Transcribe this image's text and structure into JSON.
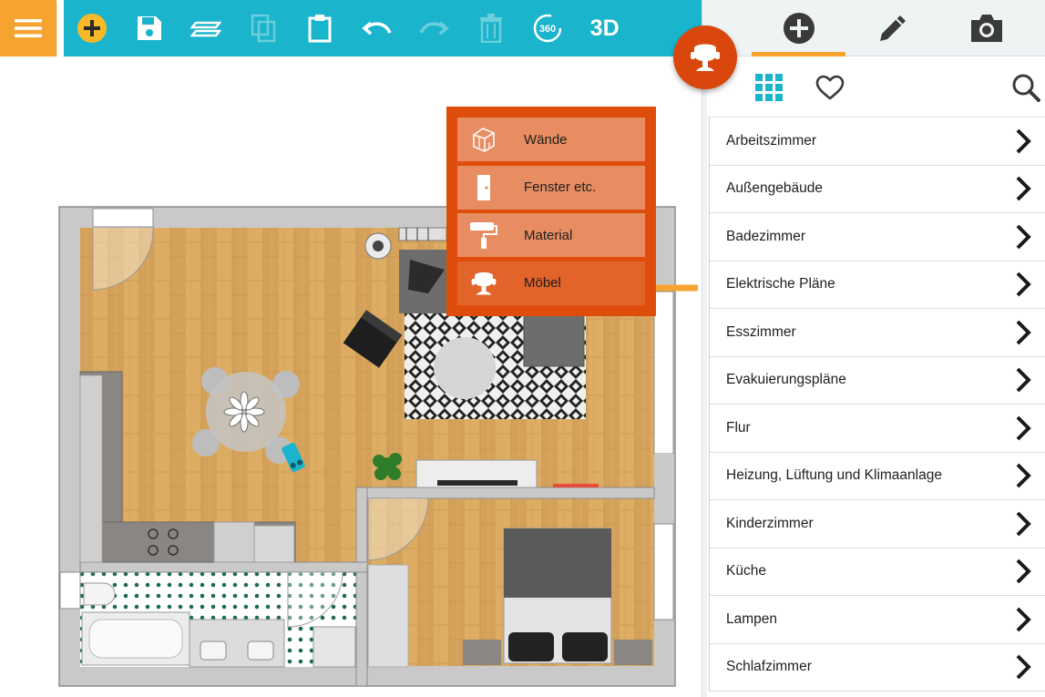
{
  "toolbar": {
    "menu_icon": "hamburger-icon",
    "buttons": [
      {
        "name": "add-button",
        "icon": "plus-circle-icon",
        "enabled": true
      },
      {
        "name": "save-button",
        "icon": "floppy-disk-icon",
        "enabled": true
      },
      {
        "name": "layers-button",
        "icon": "layers-icon",
        "enabled": true
      },
      {
        "name": "copy-button",
        "icon": "copy-icon",
        "enabled": false
      },
      {
        "name": "paste-button",
        "icon": "clipboard-icon",
        "enabled": true
      },
      {
        "name": "undo-button",
        "icon": "undo-icon",
        "enabled": true
      },
      {
        "name": "redo-button",
        "icon": "redo-icon",
        "enabled": false
      },
      {
        "name": "delete-button",
        "icon": "trash-icon",
        "enabled": false
      },
      {
        "name": "view-360-button",
        "icon": "rotate-360-icon",
        "label": "360",
        "enabled": true
      },
      {
        "name": "view-3d-button",
        "icon": "3d-icon",
        "label": "3D",
        "enabled": true
      }
    ]
  },
  "fab": {
    "icon": "armchair-icon"
  },
  "insert_menu": {
    "items": [
      {
        "label": "Wände",
        "icon": "walls-icon",
        "active": false
      },
      {
        "label": "Fenster etc.",
        "icon": "door-icon",
        "active": false
      },
      {
        "label": "Material",
        "icon": "paint-roller-icon",
        "active": false
      },
      {
        "label": "Möbel",
        "icon": "armchair-icon",
        "active": true
      }
    ]
  },
  "panel": {
    "tabs": [
      {
        "name": "tab-add",
        "icon": "plus-circle-icon",
        "active": true
      },
      {
        "name": "tab-edit",
        "icon": "pencil-icon",
        "active": false
      },
      {
        "name": "tab-camera",
        "icon": "camera-icon",
        "active": false
      }
    ],
    "sub_buttons": [
      {
        "name": "grid-view-button",
        "icon": "grid-icon"
      },
      {
        "name": "favorites-button",
        "icon": "heart-icon"
      },
      {
        "name": "search-button",
        "icon": "search-icon"
      }
    ],
    "categories": [
      "Arbeitszimmer",
      "Außengebäude",
      "Badezimmer",
      "Elektrische Pläne",
      "Esszimmer",
      "Evakuierungspläne",
      "Flur",
      "Heizung, Lüftung und Klimaanlage",
      "Kinderzimmer",
      "Küche",
      "Lampen",
      "Schlafzimmer"
    ]
  },
  "colors": {
    "toolbar_bg": "#1ab4cc",
    "menu_bg": "#f7a330",
    "accent_orange": "#de4d0b",
    "wood_floor": "#d9a85d",
    "wall_gray": "#c9c9c9"
  }
}
